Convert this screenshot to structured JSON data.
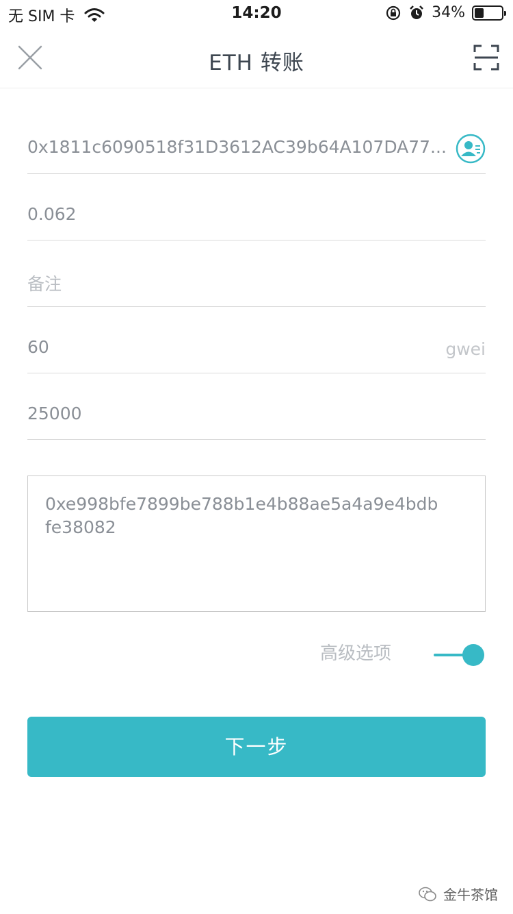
{
  "status_bar": {
    "carrier": "无 SIM 卡",
    "time": "14:20",
    "battery_percent": "34%",
    "battery_level": 0.34
  },
  "nav": {
    "title": "ETH 转账"
  },
  "form": {
    "address": "0x1811c6090518f31D3612AC39b64A107DA77...",
    "amount": "0.062",
    "memo_placeholder": "备注",
    "gas_price": "60",
    "gas_price_unit": "gwei",
    "gas_limit": "25000",
    "data_line1": "0xe998bfe7899be788b1e4b88ae5a4a9e4bdb",
    "data_line2": "fe38082"
  },
  "advanced": {
    "label": "高级选项",
    "enabled": true
  },
  "next_button": "下一步",
  "watermark": "金牛茶馆",
  "colors": {
    "accent": "#37b9c6",
    "title": "#3d4650",
    "text": "#8a8f96",
    "placeholder": "#b9bdc2"
  }
}
